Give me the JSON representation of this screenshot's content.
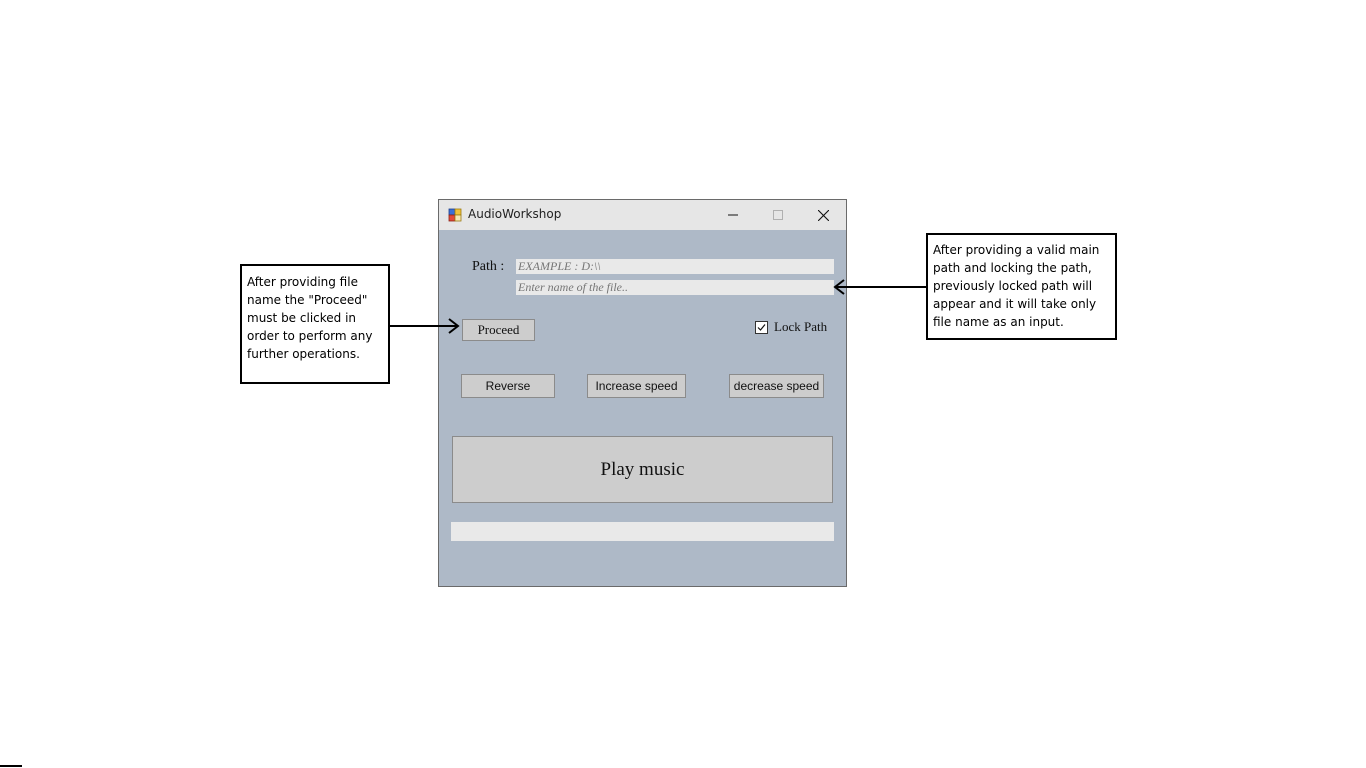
{
  "window": {
    "title": "AudioWorkshop",
    "controls": [
      "minimize-icon",
      "maximize-icon",
      "close-icon"
    ]
  },
  "form": {
    "path_label": "Path :",
    "path_placeholder": "EXAMPLE : D:\\\\",
    "file_placeholder": "Enter name of the file..",
    "proceed_label": "Proceed",
    "lock_path_label": "Lock Path",
    "lock_path_checked": true,
    "reverse_label": "Reverse",
    "increase_label": "Increase speed",
    "decrease_label": "decrease speed",
    "play_label": "Play music",
    "status_text": ""
  },
  "annotations": {
    "left_note": "After providing file\nname the \"Proceed\"\nmust be clicked in\norder to perform any\nfurther operations.",
    "right_note": "After providing a valid main\npath and locking the path,\npreviously locked path will\nappear and it will take only\nfile name as an input."
  },
  "colors": {
    "form_background": "#aeb9c7",
    "titlebar": "#e6e6e6",
    "button": "#cdcdcd",
    "textbox": "#e9e9e9"
  }
}
